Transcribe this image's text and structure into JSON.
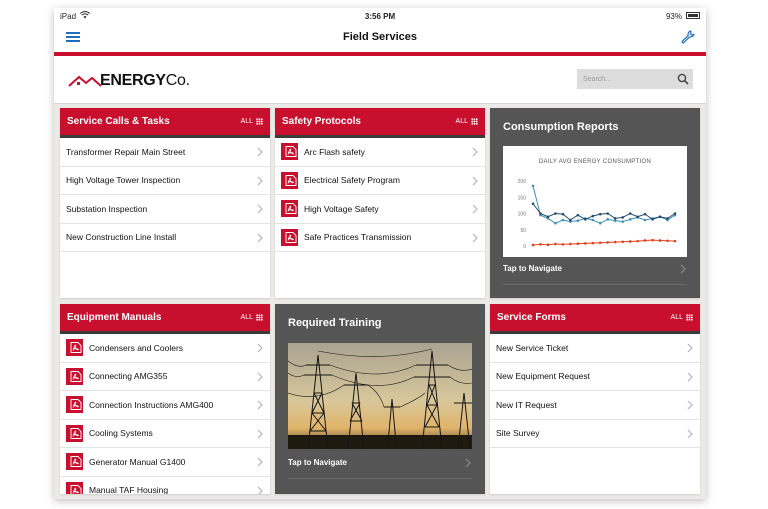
{
  "status": {
    "device": "iPad",
    "time": "3:56 PM",
    "battery": "93%"
  },
  "nav": {
    "title": "Field Services"
  },
  "brand": {
    "name_bold": "ENERGY",
    "name_suffix": "Co."
  },
  "search": {
    "placeholder": "Search..."
  },
  "colors": {
    "accent_red": "#c8102e",
    "dark_panel": "#555555",
    "nav_blue": "#1f6fbf",
    "series_blue": "#3f8fb6",
    "series_navy": "#244a6a",
    "series_red": "#e2401c"
  },
  "icons": {
    "menu": "hamburger-menu-icon",
    "settings": "wrench-icon",
    "search": "search-icon",
    "document": "pdf-icon",
    "more": "chevron-right-icon",
    "view_all": "grid-icon"
  },
  "service_calls": {
    "title": "Service Calls & Tasks",
    "all_label": "ALL",
    "items": [
      "Transformer Repair Main Street",
      "High Voltage Tower Inspection",
      "Substation Inspection",
      "New Construction Line Install"
    ]
  },
  "safety": {
    "title": "Safety Protocols",
    "all_label": "ALL",
    "items": [
      "Arc Flash safety",
      "Electrical Safety Program",
      "High Voltage Safety",
      "Safe Practices Transmission"
    ]
  },
  "consumption": {
    "title": "Consumption Reports",
    "tap_label": "Tap to Navigate"
  },
  "equipment": {
    "title": "Equipment Manuals",
    "all_label": "ALL",
    "items": [
      "Condensers and Coolers",
      "Connecting AMG355",
      "Connection Instructions AMG400",
      "Cooling Systems",
      "Generator Manual G1400",
      "Manual TAF Housing"
    ]
  },
  "training": {
    "title": "Required Training",
    "tap_label": "Tap to Navigate"
  },
  "forms": {
    "title": "Service Forms",
    "all_label": "ALL",
    "items": [
      "New Service Ticket",
      "New Equipment Request",
      "New IT Request",
      "Site Survey"
    ]
  },
  "chart_data": {
    "type": "line",
    "title": "DAILY AVG ENERGY CONSUMPTION",
    "ylim": [
      0,
      200
    ],
    "yticks": [
      "0",
      "50",
      "100",
      "150",
      "200"
    ],
    "x": [
      1,
      2,
      3,
      4,
      5,
      6,
      7,
      8,
      9,
      10,
      11,
      12,
      13,
      14,
      15,
      16,
      17,
      18,
      19,
      20
    ],
    "grid": false,
    "legend": "none",
    "series": [
      {
        "color": "#3f8fb6",
        "values": [
          185,
          95,
          85,
          70,
          80,
          75,
          78,
          85,
          80,
          70,
          82,
          78,
          75,
          82,
          88,
          80,
          85,
          90,
          80,
          95
        ]
      },
      {
        "color": "#244a6a",
        "values": [
          130,
          100,
          90,
          100,
          98,
          80,
          95,
          82,
          92,
          98,
          100,
          85,
          88,
          100,
          90,
          98,
          82,
          90,
          85,
          100
        ]
      },
      {
        "color": "#e2401c",
        "values": [
          3,
          5,
          4,
          6,
          5,
          6,
          7,
          8,
          9,
          10,
          11,
          12,
          13,
          14,
          15,
          17,
          18,
          17,
          16,
          15
        ]
      }
    ]
  }
}
